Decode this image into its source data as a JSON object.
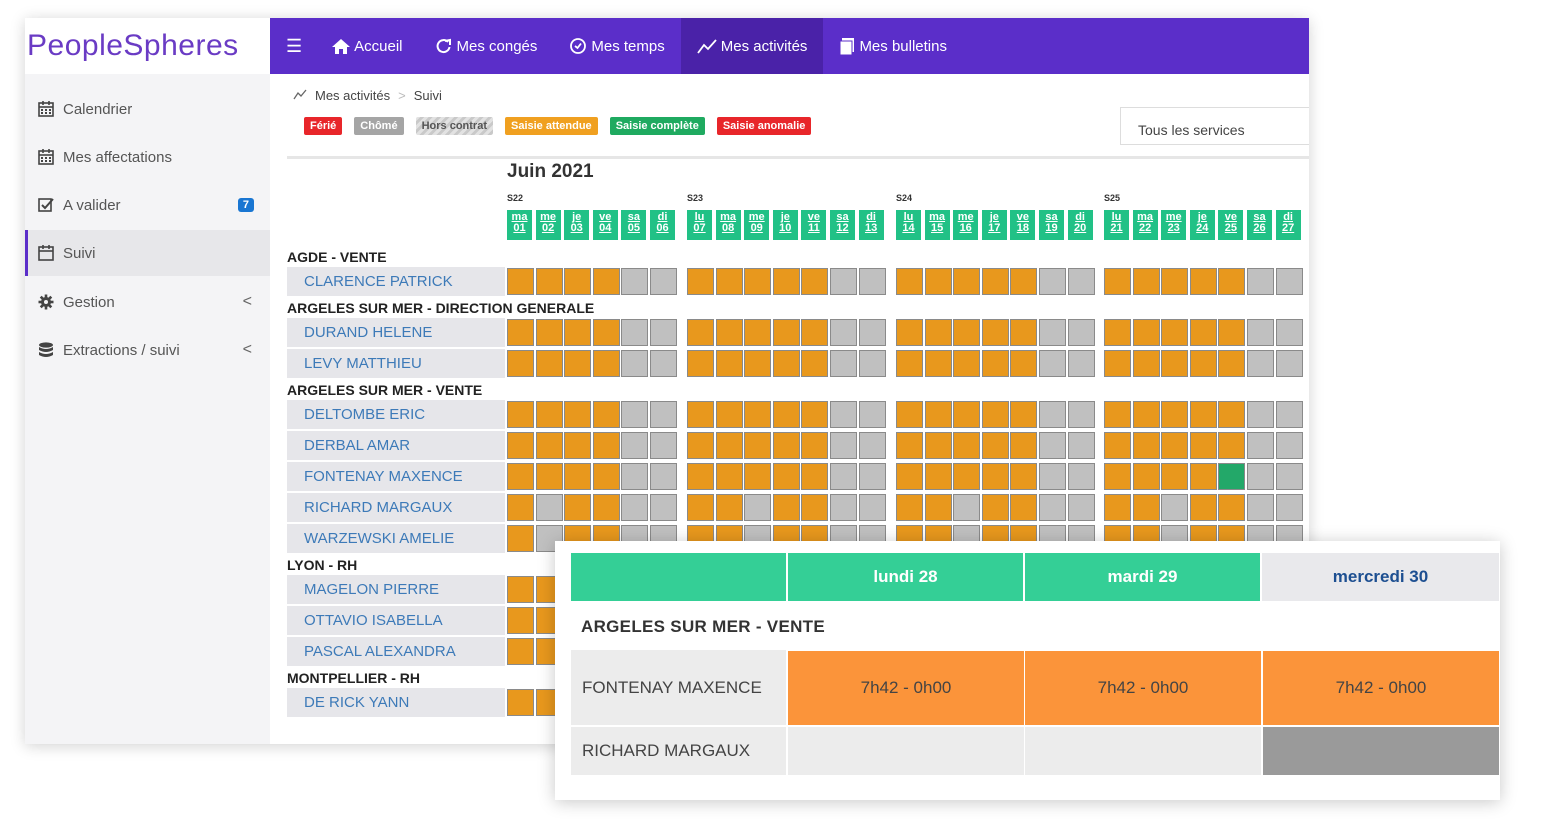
{
  "logo": {
    "text": "PeopleSpheres"
  },
  "sidebar": {
    "items": [
      {
        "label": "Calendrier",
        "icon": "calendar-icon"
      },
      {
        "label": "Mes affectations",
        "icon": "calendar-icon"
      },
      {
        "label": "A valider",
        "icon": "checkbox-icon",
        "badge": "7"
      },
      {
        "label": "Suivi",
        "icon": "calendar-icon",
        "active": true
      },
      {
        "label": "Gestion",
        "icon": "gear-icon",
        "chevron": "<"
      },
      {
        "label": "Extractions / suivi",
        "icon": "database-icon",
        "chevron": "<"
      }
    ]
  },
  "topbar": {
    "items": [
      {
        "label": "Accueil",
        "icon": "home-icon"
      },
      {
        "label": "Mes congés",
        "icon": "refresh-icon"
      },
      {
        "label": "Mes temps",
        "icon": "clock-icon"
      },
      {
        "label": "Mes activités",
        "icon": "chart-line-icon",
        "active": true
      },
      {
        "label": "Mes bulletins",
        "icon": "file-icon"
      }
    ]
  },
  "breadcrumb": {
    "root": "Mes activités",
    "current": "Suivi"
  },
  "legend": [
    {
      "label": "Férié",
      "color": "#e8262a"
    },
    {
      "label": "Chômé",
      "color": "#a5a5a5"
    },
    {
      "label": "Hors contrat",
      "color": "#d9d9d9"
    },
    {
      "label": "Saisie attendue",
      "color": "#f0a020"
    },
    {
      "label": "Saisie complète",
      "color": "#1faa60"
    },
    {
      "label": "Saisie anomalie",
      "color": "#e8262a"
    }
  ],
  "service_select": {
    "value": "Tous les services"
  },
  "calendar": {
    "month": "Juin 2021",
    "weeks": [
      {
        "label": "S22",
        "days": [
          [
            "ma",
            "01"
          ],
          [
            "me",
            "02"
          ],
          [
            "je",
            "03"
          ],
          [
            "ve",
            "04"
          ],
          [
            "sa",
            "05"
          ],
          [
            "di",
            "06"
          ]
        ]
      },
      {
        "label": "S23",
        "days": [
          [
            "lu",
            "07"
          ],
          [
            "ma",
            "08"
          ],
          [
            "me",
            "09"
          ],
          [
            "je",
            "10"
          ],
          [
            "ve",
            "11"
          ],
          [
            "sa",
            "12"
          ],
          [
            "di",
            "13"
          ]
        ]
      },
      {
        "label": "S24",
        "days": [
          [
            "lu",
            "14"
          ],
          [
            "ma",
            "15"
          ],
          [
            "me",
            "16"
          ],
          [
            "je",
            "17"
          ],
          [
            "ve",
            "18"
          ],
          [
            "sa",
            "19"
          ],
          [
            "di",
            "20"
          ]
        ]
      },
      {
        "label": "S25",
        "days": [
          [
            "lu",
            "21"
          ],
          [
            "ma",
            "22"
          ],
          [
            "me",
            "23"
          ],
          [
            "je",
            "24"
          ],
          [
            "ve",
            "25"
          ],
          [
            "sa",
            "26"
          ],
          [
            "di",
            "27"
          ]
        ]
      }
    ],
    "groups": [
      {
        "name": "AGDE - VENTE",
        "employees": [
          {
            "name": "CLARENCE PATRICK",
            "weeks": [
              "WWWWOO",
              "WWWWWOO",
              "WWWWWOO",
              "WWWWWOO"
            ]
          }
        ]
      },
      {
        "name": "ARGELES SUR MER - DIRECTION GENERALE",
        "employees": [
          {
            "name": "DURAND HELENE",
            "weeks": [
              "WWWWOO",
              "WWWWWOO",
              "WWWWWOO",
              "WWWWWOO"
            ]
          },
          {
            "name": "LEVY MATTHIEU",
            "weeks": [
              "WWWWOO",
              "WWWWWOO",
              "WWWWWOO",
              "WWWWWOO"
            ]
          }
        ]
      },
      {
        "name": "ARGELES SUR MER - VENTE",
        "employees": [
          {
            "name": "DELTOMBE ERIC",
            "weeks": [
              "WWWWOO",
              "WWWWWOO",
              "WWWWWOO",
              "WWWWWOO"
            ]
          },
          {
            "name": "DERBAL AMAR",
            "weeks": [
              "WWWWOO",
              "WWWWWOO",
              "WWWWWOO",
              "WWWWWOO"
            ]
          },
          {
            "name": "FONTENAY MAXENCE",
            "weeks": [
              "WWWWOO",
              "WWWWWOO",
              "WWWWWOO",
              "WWWWCOO"
            ]
          },
          {
            "name": "RICHARD MARGAUX",
            "weeks": [
              "WOWWOO",
              "WWOWWOO",
              "WWOWWOO",
              "WWOWWOO"
            ]
          },
          {
            "name": "WARZEWSKI AMELIE",
            "weeks": [
              "WOWWOO",
              "WWOWWOO",
              "WWOWWOO",
              "WWOWWOO"
            ]
          }
        ]
      },
      {
        "name": "LYON - RH",
        "employees": [
          {
            "name": "MAGELON PIERRE",
            "weeks": [
              "WW",
              "",
              "",
              " "
            ]
          },
          {
            "name": "OTTAVIO ISABELLA",
            "weeks": [
              "WW",
              "",
              "",
              ""
            ]
          },
          {
            "name": "PASCAL ALEXANDRA",
            "weeks": [
              "WW",
              "",
              "",
              ""
            ]
          }
        ]
      },
      {
        "name": "MONTPELLIER - RH",
        "employees": [
          {
            "name": "DE RICK YANN",
            "weeks": [
              "WW",
              "",
              "",
              ""
            ]
          }
        ]
      }
    ]
  },
  "popup": {
    "headers": [
      "lundi 28",
      "mardi 29",
      "mercredi 30"
    ],
    "group": "ARGELES SUR MER - VENTE",
    "rows": [
      {
        "name": "FONTENAY MAXENCE",
        "cells": [
          "7h42 - 0h00",
          "7h42 - 0h00",
          "7h42 - 0h00"
        ]
      },
      {
        "name": "RICHARD MARGAUX",
        "cells": [
          "",
          "",
          ""
        ]
      }
    ]
  }
}
